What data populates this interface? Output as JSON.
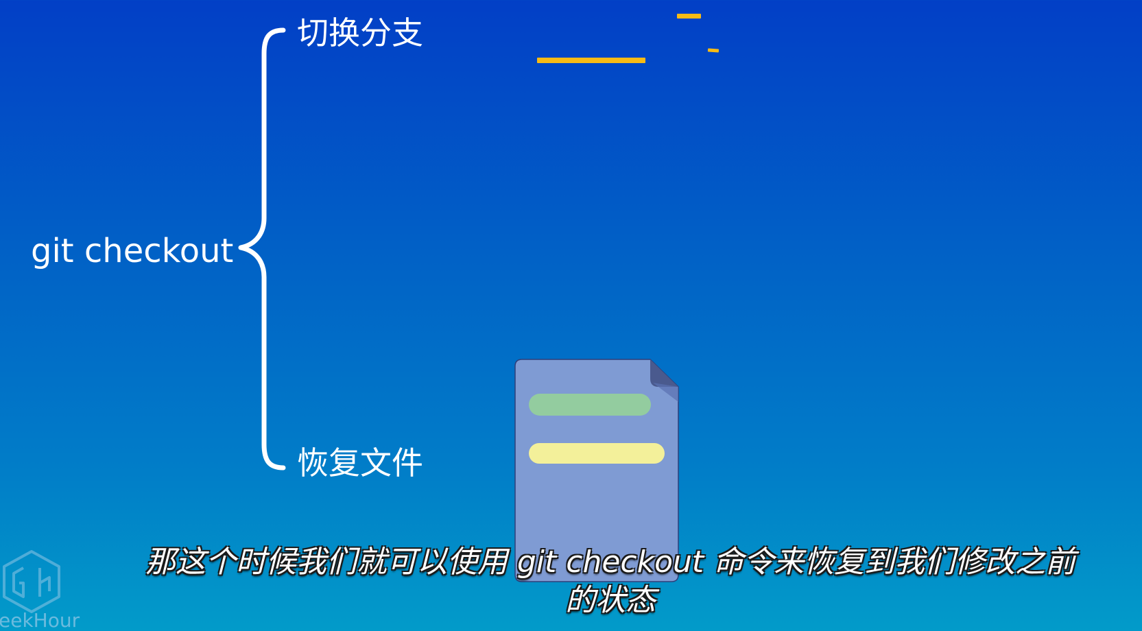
{
  "diagram": {
    "command": "git checkout",
    "branch_label": "切换分支",
    "restore_label": "恢复文件"
  },
  "subtitle": {
    "line1": "那这个时候我们就可以使用 git checkout 命令来恢复到我们修改之前",
    "line2": "的状态"
  },
  "watermark": {
    "text": "eekHour"
  },
  "colors": {
    "background_top": "#023fc6",
    "background_bottom": "#029bc9",
    "accent_yellow": "#f8bb15",
    "document_body": "#7f9bd3",
    "document_line_green": "#93cc9f",
    "document_line_yellow": "#f3f09a"
  },
  "icons": {
    "brace": "curly-brace-icon",
    "document": "document-icon",
    "logo": "geekhour-logo-icon"
  }
}
